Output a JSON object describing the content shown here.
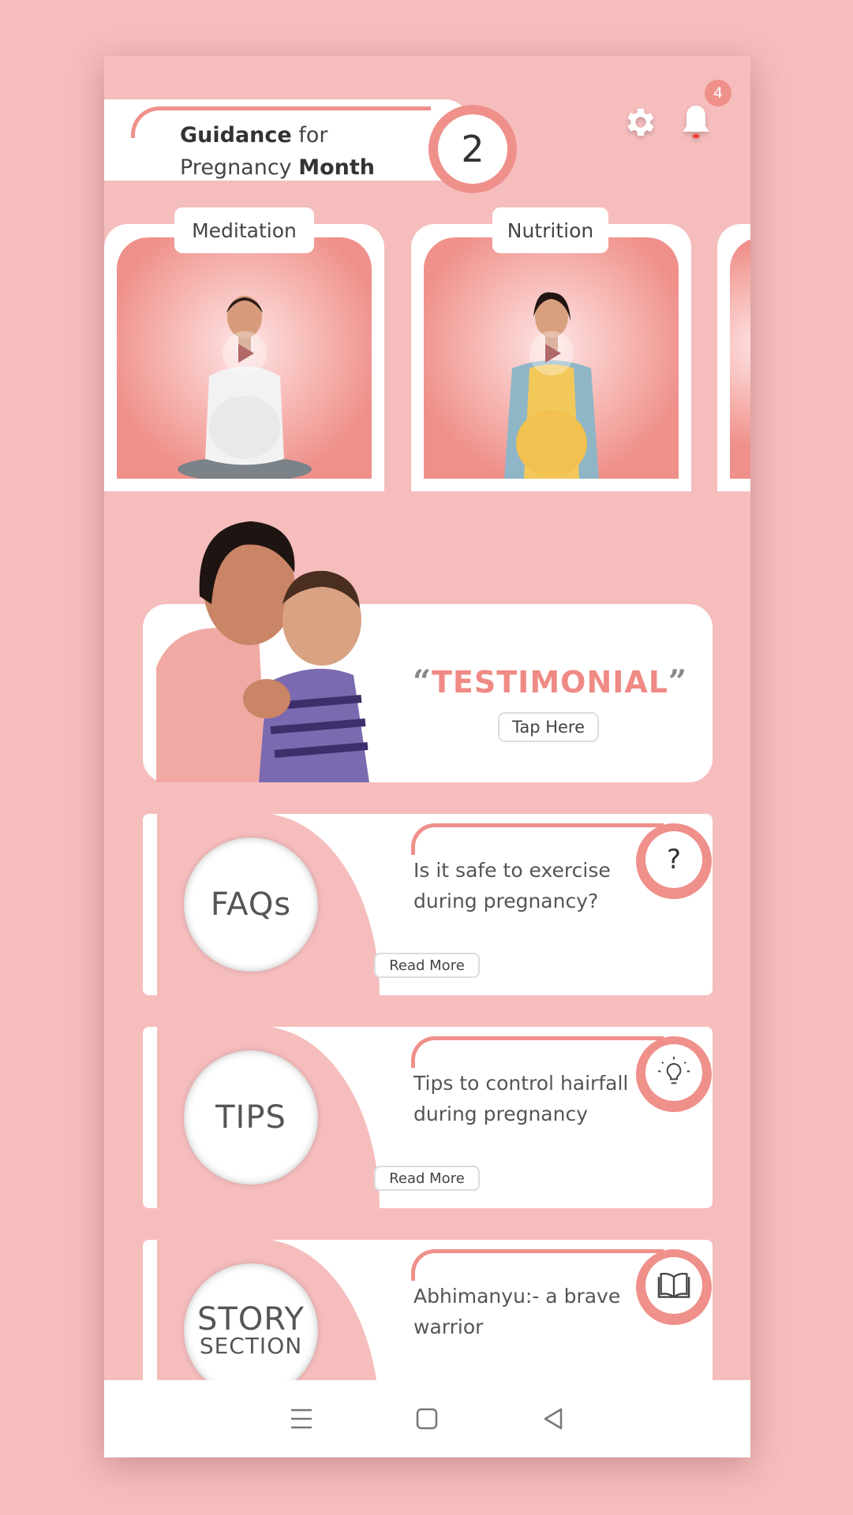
{
  "header": {
    "title_bold_1": "Guidance",
    "title_rest_1": " for",
    "title_rest_2": "Pregnancy ",
    "title_bold_2": "Month",
    "month": "2"
  },
  "top_icons": {
    "settings": "gear-icon",
    "notifications": "bell-icon",
    "notification_count": "4"
  },
  "video_cards": [
    {
      "label": "Meditation",
      "icon": "play-icon"
    },
    {
      "label": "Nutrition",
      "icon": "play-icon"
    }
  ],
  "testimonial": {
    "title": "TESTIMONIAL",
    "open_quote": "“",
    "close_quote": "”",
    "button": "Tap Here"
  },
  "info_cards": [
    {
      "badge": "FAQs",
      "text": "Is it safe to exercise during pregnancy?",
      "button": "Read More",
      "icon": "question-icon",
      "icon_glyph": "?"
    },
    {
      "badge": "TIPS",
      "text": "Tips to control hairfall during pregnancy",
      "button": "Read More",
      "icon": "lightbulb-icon"
    },
    {
      "badge": "STORY",
      "badge_sub": "SECTION",
      "text": "Abhimanyu:- a brave warrior",
      "icon": "book-icon"
    }
  ],
  "colors": {
    "background": "#f6bdbd",
    "accent": "#ef908b",
    "card": "#ffffff"
  },
  "navbar": {
    "items": [
      "menu-icon",
      "home-icon",
      "back-icon"
    ]
  }
}
